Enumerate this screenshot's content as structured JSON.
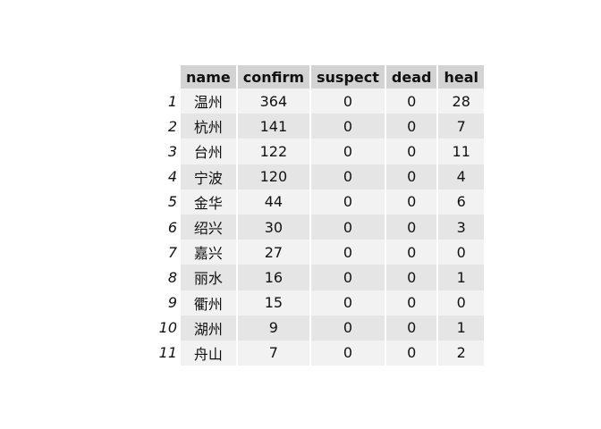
{
  "table": {
    "columns": [
      "name",
      "confirm",
      "suspect",
      "dead",
      "heal"
    ],
    "rows": [
      {
        "index": "1",
        "name": "温州",
        "confirm": "364",
        "suspect": "0",
        "dead": "0",
        "heal": "28"
      },
      {
        "index": "2",
        "name": "杭州",
        "confirm": "141",
        "suspect": "0",
        "dead": "0",
        "heal": "7"
      },
      {
        "index": "3",
        "name": "台州",
        "confirm": "122",
        "suspect": "0",
        "dead": "0",
        "heal": "11"
      },
      {
        "index": "4",
        "name": "宁波",
        "confirm": "120",
        "suspect": "0",
        "dead": "0",
        "heal": "4"
      },
      {
        "index": "5",
        "name": "金华",
        "confirm": "44",
        "suspect": "0",
        "dead": "0",
        "heal": "6"
      },
      {
        "index": "6",
        "name": "绍兴",
        "confirm": "30",
        "suspect": "0",
        "dead": "0",
        "heal": "3"
      },
      {
        "index": "7",
        "name": "嘉兴",
        "confirm": "27",
        "suspect": "0",
        "dead": "0",
        "heal": "0"
      },
      {
        "index": "8",
        "name": "丽水",
        "confirm": "16",
        "suspect": "0",
        "dead": "0",
        "heal": "1"
      },
      {
        "index": "9",
        "name": "衢州",
        "confirm": "15",
        "suspect": "0",
        "dead": "0",
        "heal": "0"
      },
      {
        "index": "10",
        "name": "湖州",
        "confirm": "9",
        "suspect": "0",
        "dead": "0",
        "heal": "1"
      },
      {
        "index": "11",
        "name": "舟山",
        "confirm": "7",
        "suspect": "0",
        "dead": "0",
        "heal": "2"
      }
    ]
  }
}
